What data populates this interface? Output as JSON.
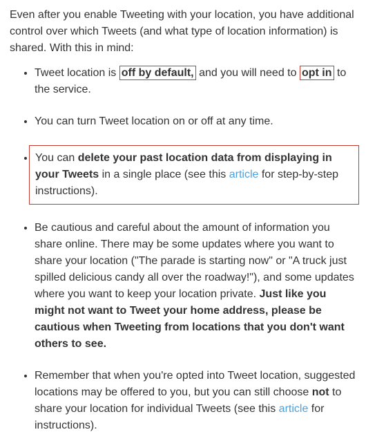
{
  "intro": "Even after you enable Tweeting with your location, you have additional control over which Tweets (and what type of location information) is shared. With this in mind:",
  "items": {
    "i1": {
      "a": "Tweet location is ",
      "b": "off by default,",
      "c": " and you will need to ",
      "d": "opt in",
      "e": " to the service."
    },
    "i2": {
      "a": "You can turn Tweet location on or off at any time."
    },
    "i3": {
      "a": "You can ",
      "b": "delete your past location data from displaying in your Tweets",
      "c": " in a single place (see this ",
      "link": "article",
      "d": " for step-by-step instructions)."
    },
    "i4": {
      "a": "Be cautious and careful about the amount of information you share online. There may be some updates where you want to share your location (\"The parade is starting now\" or \"A truck just spilled delicious candy all over the roadway!\"), and some updates where you want to keep your location private. ",
      "b": "Just like you might not want to Tweet your home address, please be cautious when Tweeting from locations that you don't want others to see."
    },
    "i5": {
      "a": "Remember that when you're opted into Tweet location, suggested locations may be offered to you, but you can still choose ",
      "b": "not",
      "c": " to share your location for individual Tweets (see this ",
      "link": "article",
      "d": " for instructions)."
    }
  }
}
